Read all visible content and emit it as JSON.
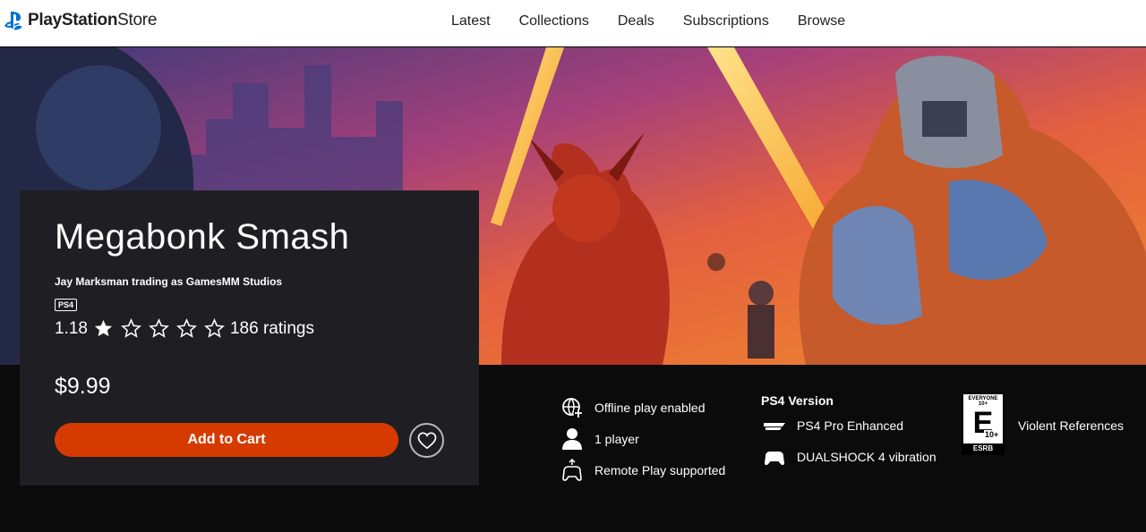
{
  "header": {
    "brand_bold": "PlayStation",
    "brand_light": "Store",
    "nav": [
      "Latest",
      "Collections",
      "Deals",
      "Subscriptions",
      "Browse"
    ]
  },
  "product": {
    "title": "Megabonk Smash",
    "publisher": "Jay Marksman trading as GamesMM Studios",
    "platform": "PS4",
    "rating_value": "1.18",
    "rating_stars": 1,
    "rating_count": "186 ratings",
    "price": "$9.99",
    "cart_label": "Add to Cart"
  },
  "features": {
    "offline": "Offline play enabled",
    "players": "1 player",
    "remote": "Remote Play supported"
  },
  "ps4_version": {
    "title": "PS4 Version",
    "pro": "PS4 Pro Enhanced",
    "vibration": "DUALSHOCK 4 vibration"
  },
  "esrb": {
    "top": "EVERYONE 10+",
    "letter": "E",
    "age": "10+",
    "bottom": "ESRB",
    "descriptor": "Violent References"
  },
  "colors": {
    "accent": "#d53b00",
    "card": "#1f1f23",
    "background": "#0b0b0c"
  }
}
